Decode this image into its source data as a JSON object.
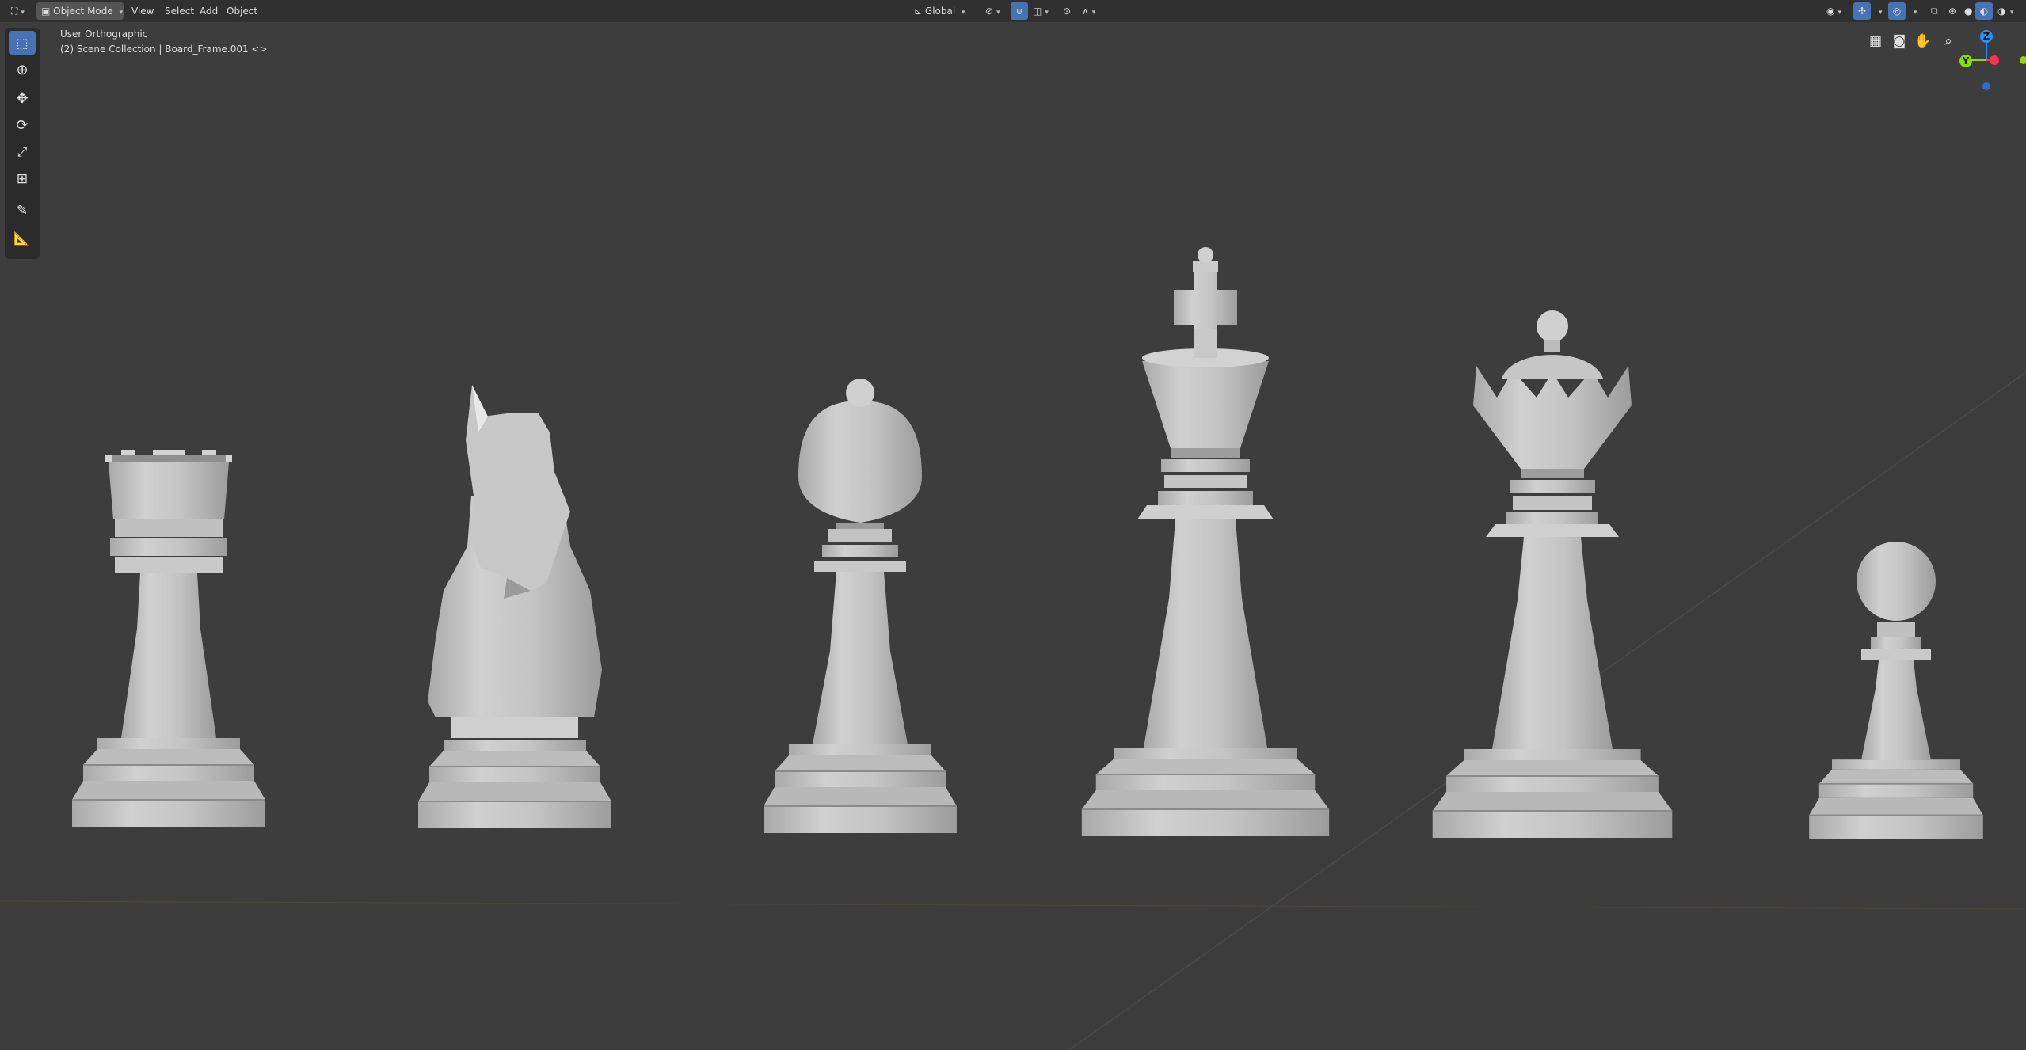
{
  "header": {
    "mode_label": "Object Mode",
    "menus": [
      "View",
      "Select",
      "Add",
      "Object"
    ],
    "transform_orientation": "Global"
  },
  "viewport": {
    "view_name": "User Orthographic",
    "collection_info": "(2) Scene Collection | Board_Frame.001 <>"
  },
  "toolbar": {
    "tools": [
      "select-box",
      "cursor",
      "move",
      "rotate",
      "scale",
      "transform",
      "annotate",
      "measure"
    ]
  },
  "gizmo": {
    "z": "Z",
    "y": "Y",
    "x": "X"
  },
  "scene": {
    "pieces": [
      "rook",
      "knight",
      "bishop",
      "king",
      "queen",
      "pawn"
    ]
  },
  "colors": {
    "background": "#3d3d3d",
    "header": "#303030",
    "accent": "#4772b3",
    "piece": "#c7c7c7",
    "axis_x": "#ff3352",
    "axis_y": "#8bdc00",
    "axis_z": "#2890ff"
  }
}
